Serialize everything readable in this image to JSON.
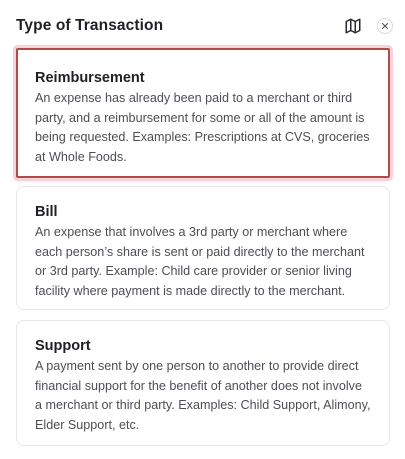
{
  "header": {
    "title": "Type of Transaction",
    "map_icon": "map-icon",
    "close_icon": "close-icon"
  },
  "options": [
    {
      "title": "Reimbursement",
      "description": "An expense has already been paid to a merchant or third party, and a reimbursement for some or all of the amount is being requested. Examples: Prescriptions at CVS, groceries at Whole Foods.",
      "selected": true
    },
    {
      "title": "Bill",
      "description": "An expense that involves a 3rd party or merchant where each person’s share is sent or paid directly to the merchant or 3rd party. Example: Child care provider or senior living facility where payment is made directly to the merchant.",
      "selected": false
    },
    {
      "title": "Support",
      "description": "A payment sent by one person to another to provide direct financial support for the benefit of another does not involve a merchant or third party. Examples: Child Support, Alimony, Elder Support, etc.",
      "selected": false
    }
  ],
  "colors": {
    "selected_border": "#b34a4a",
    "selected_glow": "#f6d3d9",
    "card_border": "#e6e7ea",
    "title_text": "#1f2024",
    "body_text": "#4d4e55"
  }
}
